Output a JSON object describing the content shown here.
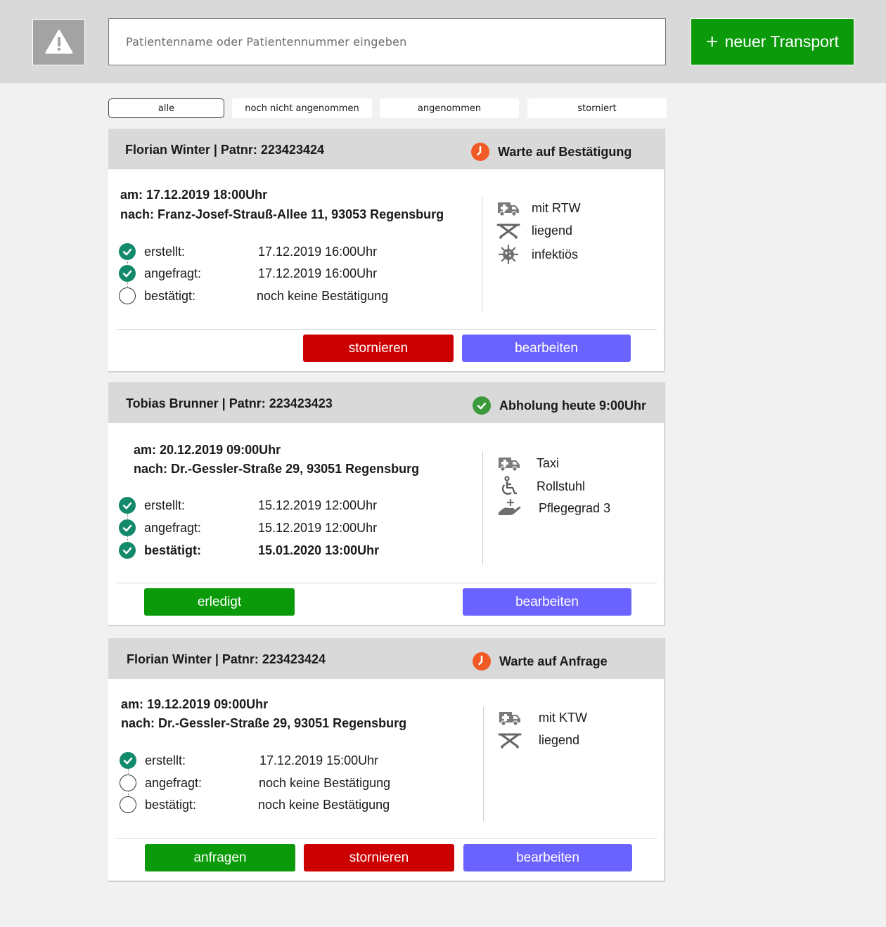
{
  "header": {
    "search_placeholder": "Patientenname oder Patientennummer eingeben",
    "new_transport_label": "neuer Transport",
    "warning_icon": "warning-triangle-icon"
  },
  "filters": [
    "alle",
    "noch nicht angenommen",
    "angenommen",
    "storniert"
  ],
  "active_filter": "alle",
  "colors": {
    "header_bg": "#d9d9d9",
    "green": "#0a9a0a",
    "red": "#cc0000",
    "blue": "#6b63ff",
    "status_orange": "#f15a24",
    "status_green": "#3c9a3c",
    "check_teal": "#138a6b"
  },
  "cards": [
    {
      "title": "Florian Winter | Patnr: 223423424",
      "status": "Warte auf Bestätigung",
      "status_icon": "clock-icon",
      "date": "am: 17.12.2019 18:00Uhr",
      "destination": "nach: Franz-Josef-Strauß-Allee 11, 93053 Regensburg",
      "timeline": [
        {
          "label": "erstellt:",
          "value": "17.12.2019 16:00Uhr",
          "done": true
        },
        {
          "label": "angefragt:",
          "value": "17.12.2019 16:00Uhr",
          "done": true
        },
        {
          "label": "bestätigt:",
          "value": "noch keine Bestätigung",
          "done": false
        }
      ],
      "features": [
        {
          "icon": "ambulance-icon",
          "label": "mit RTW"
        },
        {
          "icon": "stretcher-icon",
          "label": "liegend"
        },
        {
          "icon": "virus-icon",
          "label": "infektiös"
        }
      ],
      "buttons": [
        "stornieren",
        "bearbeiten"
      ]
    },
    {
      "title": "Tobias Brunner | Patnr: 223423423",
      "status": "Abholung heute 9:00Uhr",
      "status_icon": "check-circle-icon",
      "date": "am: 20.12.2019 09:00Uhr",
      "destination": "nach: Dr.-Gessler-Straße 29, 93051 Regensburg",
      "timeline": [
        {
          "label": "erstellt:",
          "value": "15.12.2019 12:00Uhr",
          "done": true
        },
        {
          "label": "angefragt:",
          "value": "15.12.2019 12:00Uhr",
          "done": true
        },
        {
          "label": "bestätigt:",
          "value": "15.01.2020 13:00Uhr",
          "done": true
        }
      ],
      "features": [
        {
          "icon": "ambulance-icon",
          "label": "Taxi"
        },
        {
          "icon": "wheelchair-icon",
          "label": "Rollstuhl"
        },
        {
          "icon": "care-hand-icon",
          "label": "Pflegegrad 3"
        }
      ],
      "buttons": [
        "erledigt",
        "bearbeiten"
      ]
    },
    {
      "title": "Florian Winter | Patnr: 223423424",
      "status": "Warte auf Anfrage",
      "status_icon": "clock-icon",
      "date": "am: 19.12.2019 09:00Uhr",
      "destination": "nach: Dr.-Gessler-Straße 29, 93051 Regensburg",
      "timeline": [
        {
          "label": "erstellt:",
          "value": "17.12.2019 15:00Uhr",
          "done": true
        },
        {
          "label": "angefragt:",
          "value": "noch keine Bestätigung",
          "done": false
        },
        {
          "label": "bestätigt:",
          "value": "noch keine Bestätigung",
          "done": false
        }
      ],
      "features": [
        {
          "icon": "ambulance-icon",
          "label": "mit KTW"
        },
        {
          "icon": "stretcher-icon",
          "label": "liegend"
        }
      ],
      "buttons": [
        "anfragen",
        "stornieren",
        "bearbeiten"
      ]
    }
  ]
}
